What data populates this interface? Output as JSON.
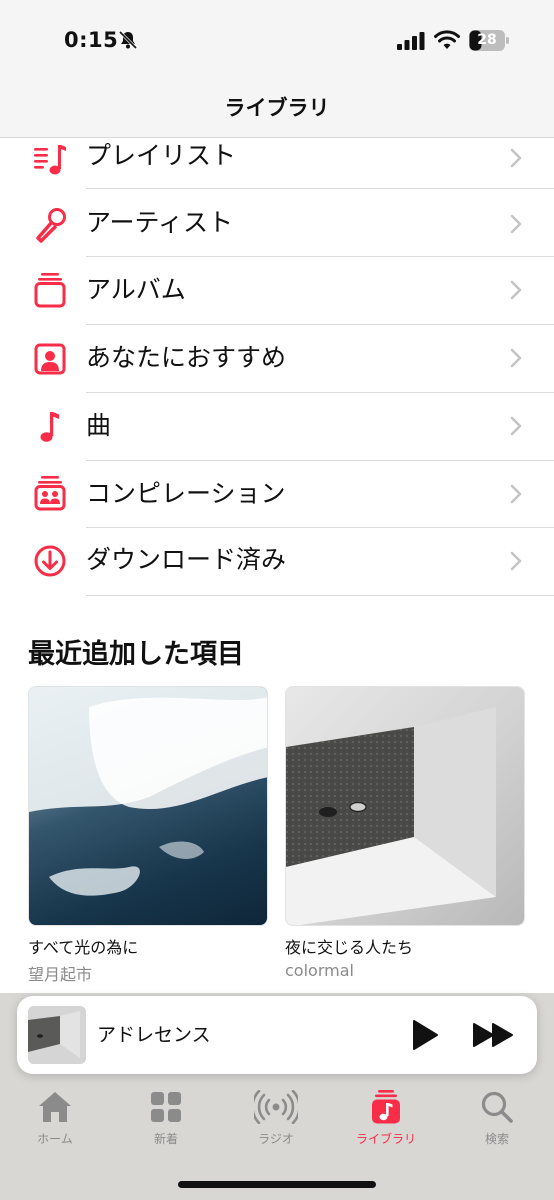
{
  "status_bar": {
    "time": "0:15",
    "battery": "28"
  },
  "nav": {
    "title": "ライブラリ"
  },
  "library_items": [
    {
      "label": "プレイリスト",
      "icon": "playlist-icon"
    },
    {
      "label": "アーティスト",
      "icon": "microphone-icon"
    },
    {
      "label": "アルバム",
      "icon": "album-stack-icon"
    },
    {
      "label": "あなたにおすすめ",
      "icon": "person-square-icon"
    },
    {
      "label": "曲",
      "icon": "music-note-icon"
    },
    {
      "label": "コンピレーション",
      "icon": "compilation-icon"
    },
    {
      "label": "ダウンロード済み",
      "icon": "download-circle-icon"
    }
  ],
  "recently_added": {
    "title": "最近追加した項目",
    "albums": [
      {
        "title": "すべて光の為に",
        "artist": "望月起市"
      },
      {
        "title": "夜に交じる人たち",
        "artist": "colormal"
      }
    ]
  },
  "mini_player": {
    "title": "アドレセンス"
  },
  "tab_bar": {
    "tabs": [
      {
        "label": "ホーム",
        "icon": "house-icon",
        "active": false
      },
      {
        "label": "新着",
        "icon": "grid-icon",
        "active": false
      },
      {
        "label": "ラジオ",
        "icon": "radio-waves-icon",
        "active": false
      },
      {
        "label": "ライブラリ",
        "icon": "library-music-icon",
        "active": true
      },
      {
        "label": "検索",
        "icon": "magnifier-icon",
        "active": false
      }
    ]
  },
  "colors": {
    "accent": "#fa2d48",
    "chevron": "#c4c4c6",
    "inactive_tab": "#8b8b8b"
  }
}
